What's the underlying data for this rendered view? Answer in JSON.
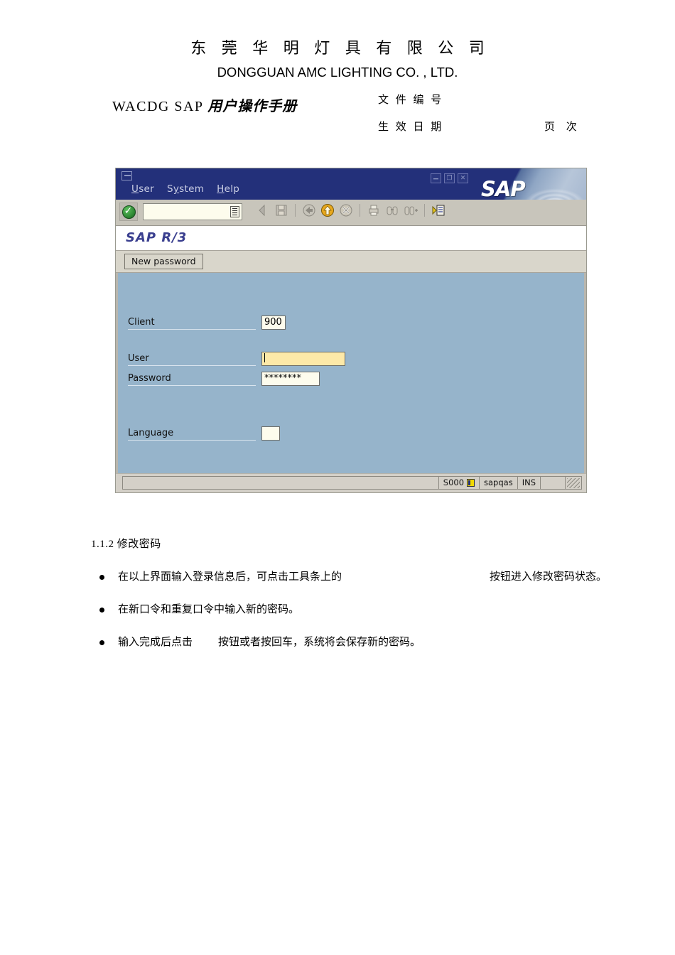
{
  "document": {
    "company_name_cn": "东 莞 华 明 灯 具 有 限 公 司",
    "company_name_en": "DONGGUAN AMC LIGHTING CO. , LTD.",
    "manual_title_latin": "WACDG SAP ",
    "manual_title_cn": "用户操作手册",
    "doc_number_label": "文 件 编 号",
    "effective_date_label": "生 效 日 期",
    "page_label": "页  次"
  },
  "sap_window": {
    "system_icon": "sap-system-menu-icon",
    "menus": [
      {
        "label_pre": "",
        "accel": "U",
        "label_post": "ser"
      },
      {
        "label_pre": "S",
        "accel": "y",
        "label_post": "stem"
      },
      {
        "label_pre": "",
        "accel": "H",
        "label_post": "elp"
      }
    ],
    "window_controls": {
      "minimize": "_",
      "maximize": "▫",
      "close": "x"
    },
    "logo_text": "SAP",
    "toolbar": {
      "enter_button": "green-check-enter-icon",
      "command_field_value": "",
      "command_field_list_icon": "command-history-icon",
      "icons": [
        "enter-arrow-icon",
        "save-icon",
        "back-icon",
        "exit-icon",
        "cancel-icon",
        "print-icon",
        "find-icon",
        "find-next-icon",
        "customize-local-layout-icon"
      ]
    },
    "title_strip": "SAP R/3",
    "new_password_button": "New password",
    "form": {
      "client": {
        "label": "Client",
        "value": "900"
      },
      "user": {
        "label": "User",
        "value": ""
      },
      "password": {
        "label": "Password",
        "value": "********"
      },
      "language": {
        "label": "Language",
        "value": ""
      }
    },
    "status_bar": {
      "message": "",
      "system": "S000",
      "server_icon": "server-status-icon",
      "host": "sapqas",
      "insert_mode": "INS",
      "resize_grip": "resize-grip-icon"
    }
  },
  "content": {
    "section_heading": "1.1.2 修改密码",
    "bullets": [
      {
        "text_before": "在以上界面输入登录信息后，可点击工具条上的",
        "text_after": "按钮进入修改密码状态。",
        "gap": "wide"
      },
      {
        "text_before": "在新口令和重复口令中输入新的密码。",
        "text_after": "",
        "gap": "none"
      },
      {
        "text_before": "输入完成后点击",
        "text_after": "按钮或者按回车，系统将会保存新的密码。",
        "gap": "small"
      }
    ]
  },
  "colors": {
    "titlebar": "#23307a",
    "form_background": "#96b4cb",
    "toolbar": "#c8c5bb",
    "focused_field": "#fde9a8",
    "field_background": "#fdfced",
    "sap_r3_text": "#3a3f8f"
  }
}
